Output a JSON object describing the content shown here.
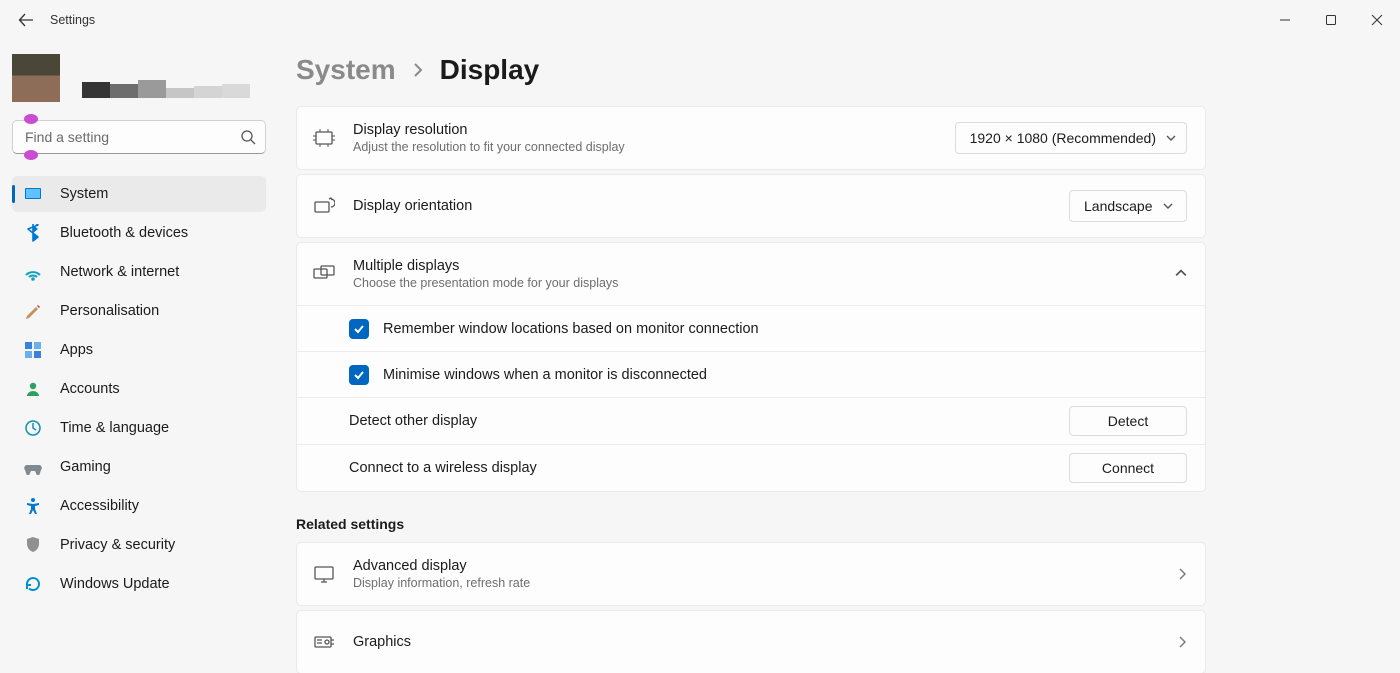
{
  "window": {
    "title": "Settings"
  },
  "search": {
    "placeholder": "Find a setting"
  },
  "nav": {
    "system": "System",
    "bluetooth": "Bluetooth & devices",
    "network": "Network & internet",
    "personalisation": "Personalisation",
    "apps": "Apps",
    "accounts": "Accounts",
    "time": "Time & language",
    "gaming": "Gaming",
    "accessibility": "Accessibility",
    "privacy": "Privacy & security",
    "update": "Windows Update"
  },
  "breadcrumb": {
    "parent": "System",
    "current": "Display"
  },
  "rows": {
    "resolution": {
      "title": "Display resolution",
      "sub": "Adjust the resolution to fit your connected display",
      "value": "1920 × 1080 (Recommended)"
    },
    "orientation": {
      "title": "Display orientation",
      "value": "Landscape"
    },
    "multiple": {
      "title": "Multiple displays",
      "sub": "Choose the presentation mode for your displays"
    },
    "remember": {
      "label": "Remember window locations based on monitor connection"
    },
    "minimise": {
      "label": "Minimise windows when a monitor is disconnected"
    },
    "detect": {
      "label": "Detect other display",
      "button": "Detect"
    },
    "connect": {
      "label": "Connect to a wireless display",
      "button": "Connect"
    }
  },
  "related": {
    "heading": "Related settings",
    "advanced": {
      "title": "Advanced display",
      "sub": "Display information, refresh rate"
    },
    "graphics": {
      "title": "Graphics"
    }
  }
}
